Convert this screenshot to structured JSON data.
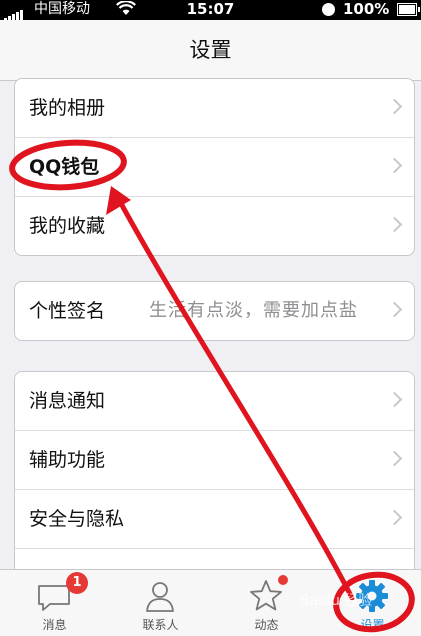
{
  "status_bar": {
    "carrier": "中国移动",
    "time": "15:07",
    "battery": "100%"
  },
  "nav": {
    "title": "设置"
  },
  "groups": [
    [
      {
        "label": "我的相册"
      },
      {
        "label": "QQ钱包"
      },
      {
        "label": "我的收藏"
      }
    ],
    [
      {
        "label": "个性签名",
        "value": "生活有点淡，需要加点盐"
      }
    ],
    [
      {
        "label": "消息通知"
      },
      {
        "label": "辅助功能"
      },
      {
        "label": "安全与隐私"
      }
    ]
  ],
  "tabs": [
    {
      "label": "消息",
      "badge": "1",
      "icon": "message-bubble-icon"
    },
    {
      "label": "联系人",
      "icon": "contact-person-icon"
    },
    {
      "label": "动态",
      "icon": "star-icon"
    },
    {
      "label": "设置",
      "icon": "gear-icon",
      "active": true
    }
  ],
  "annotation_color": "#e0141e",
  "accent_color": "#1a8cd8",
  "watermark": "Baidu 经验"
}
